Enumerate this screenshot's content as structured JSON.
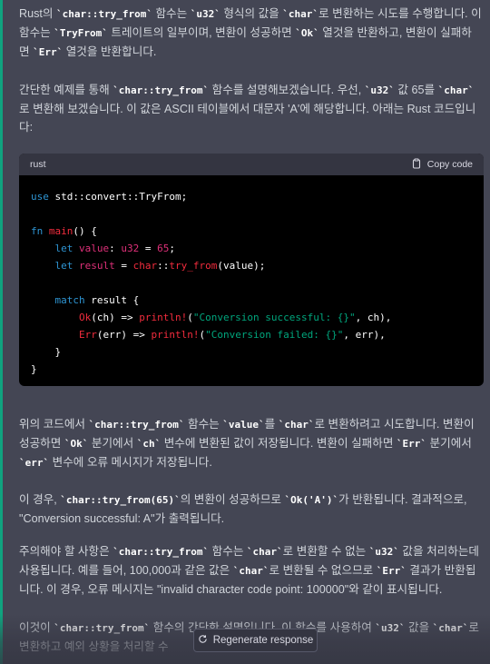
{
  "colors": {
    "background": "#444654",
    "accent": "#10a37f",
    "code_bg": "#000000",
    "code_header": "#343541"
  },
  "paragraphs": {
    "p1": {
      "t1": "Rust의 ",
      "c1": "`char::try_from`",
      "t2": " 함수는 ",
      "c2": "`u32`",
      "t3": " 형식의 값을 ",
      "c3": "`char`",
      "t4": "로 변환하는 시도를 수행합니다. 이 함수는 ",
      "c4": "`TryFrom`",
      "t5": " 트레이트의 일부이며, 변환이 성공하면 ",
      "c5": "`Ok`",
      "t6": " 열것을 반환하고, 변환이 실패하면 ",
      "c6": "`Err`",
      "t7": " 열것을 반환합니다."
    },
    "p2": {
      "t1": "간단한 예제를 통해 ",
      "c1": "`char::try_from`",
      "t2": " 함수를 설명해보겠습니다. 우선, ",
      "c2": "`u32`",
      "t3": " 값 65를 ",
      "c3": "`char`",
      "t4": "로 변환해 보겠습니다. 이 값은 ASCII 테이블에서 대문자 'A'에 해당합니다. 아래는 Rust 코드입니다:"
    },
    "p3": {
      "t1": "위의 코드에서 ",
      "c1": "`char::try_from`",
      "t2": " 함수는 ",
      "c2": "`value`",
      "t3": "를 ",
      "c3": "`char`",
      "t4": "로 변환하려고 시도합니다. 변환이 성공하면 ",
      "c4": "`Ok`",
      "t5": " 분기에서 ",
      "c5": "`ch`",
      "t6": " 변수에 변환된 값이 저장됩니다. 변환이 실패하면 ",
      "c6": "`Err`",
      "t7": " 분기에서 ",
      "c7": "`err`",
      "t8": " 변수에 오류 메시지가 저장됩니다."
    },
    "p4": {
      "t1": "이 경우, ",
      "c1": "`char::try_from(65)`",
      "t2": "의 변환이 성공하므로 ",
      "c2": "`Ok('A')`",
      "t3": "가 반환됩니다. 결과적으로, \"Conversion successful: A\"가 출력됩니다."
    },
    "p5": {
      "t1": "주의해야 할 사항은 ",
      "c1": "`char::try_from`",
      "t2": " 함수는 ",
      "c2": "`char`",
      "t3": "로 변환할 수 없는 ",
      "c3": "`u32`",
      "t4": " 값을 처리하는데 사용됩니다. 예를 들어, 100,000과 같은 값은 ",
      "c4": "`char`",
      "t5": "로 변환될 수 없으므로 ",
      "c5": "`Err`",
      "t6": " 결과가 반환됩니다. 이 경우, 오류 메시지는 \"invalid character code point: 100000\"와 같이 표시됩니다."
    },
    "p6": {
      "t1": "이것이 ",
      "c1": "`char::try_from`",
      "t2": " 함수의 간단한 설명입니다. 이 함수를 사용하여 ",
      "c2": "`u32`",
      "t3": " 값을 ",
      "c3": "`char`",
      "t4": "로 변환하고 예외 상황을 처리할 수"
    }
  },
  "code_block": {
    "language": "rust",
    "copy_label": "Copy code",
    "lines": {
      "l1a": "use",
      "l1b": " std::convert::TryFrom;",
      "l3a": "fn",
      "l3b": " ",
      "l3c": "main",
      "l3d": "() {",
      "l4a": "    ",
      "l4b": "let",
      "l4c": " ",
      "l4d": "value",
      "l4e": ": ",
      "l4f": "u32",
      "l4g": " = ",
      "l4h": "65",
      "l4i": ";",
      "l5a": "    ",
      "l5b": "let",
      "l5c": " ",
      "l5d": "result",
      "l5e": " = ",
      "l5f": "char",
      "l5g": "::",
      "l5h": "try_from",
      "l5i": "(value);",
      "l7a": "    ",
      "l7b": "match",
      "l7c": " result {",
      "l8a": "        ",
      "l8b": "Ok",
      "l8c": "(ch) => ",
      "l8d": "println!",
      "l8e": "(",
      "l8f": "\"Conversion successful: {}\"",
      "l8g": ", ch),",
      "l9a": "        ",
      "l9b": "Err",
      "l9c": "(err) => ",
      "l9d": "println!",
      "l9e": "(",
      "l9f": "\"Conversion failed: {}\"",
      "l9g": ", err),",
      "l10": "    }",
      "l11": "}"
    }
  },
  "regenerate_label": "Regenerate response",
  "icons": {
    "copy": "clipboard-icon",
    "regenerate": "refresh-icon"
  }
}
